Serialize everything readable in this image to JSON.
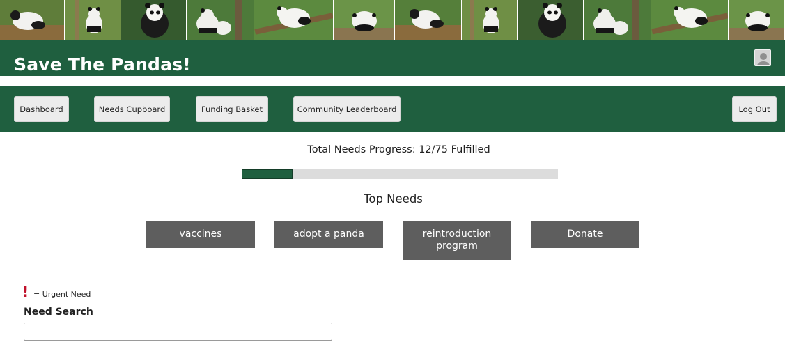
{
  "header": {
    "title": "Save The Pandas!",
    "banner_photos": [
      "panda-photo-1",
      "panda-photo-2",
      "panda-photo-3",
      "panda-photo-4",
      "panda-photo-5",
      "panda-photo-6",
      "panda-photo-7",
      "panda-photo-8",
      "panda-photo-9",
      "panda-photo-10",
      "panda-photo-11",
      "panda-photo-12"
    ],
    "avatar_icon": "user-avatar-icon"
  },
  "nav": {
    "dashboard": "Dashboard",
    "needs_cupboard": "Needs Cupboard",
    "funding_basket": "Funding Basket",
    "community_leaderboard": "Community Leaderboard",
    "log_out": "Log Out"
  },
  "progress": {
    "label": "Total Needs Progress: 12/75 Fulfilled",
    "fulfilled": 12,
    "total": 75
  },
  "top_needs": {
    "title": "Top Needs",
    "items": [
      "vaccines",
      "adopt a panda",
      "reintroduction program",
      "Donate"
    ]
  },
  "legend": {
    "mark": "!",
    "text": "= Urgent Need"
  },
  "search": {
    "label": "Need Search",
    "value": "",
    "placeholder": ""
  },
  "colors": {
    "brand_green": "#1f5f3f",
    "need_button": "#5e5e5e",
    "urgent_red": "#c0102a"
  }
}
